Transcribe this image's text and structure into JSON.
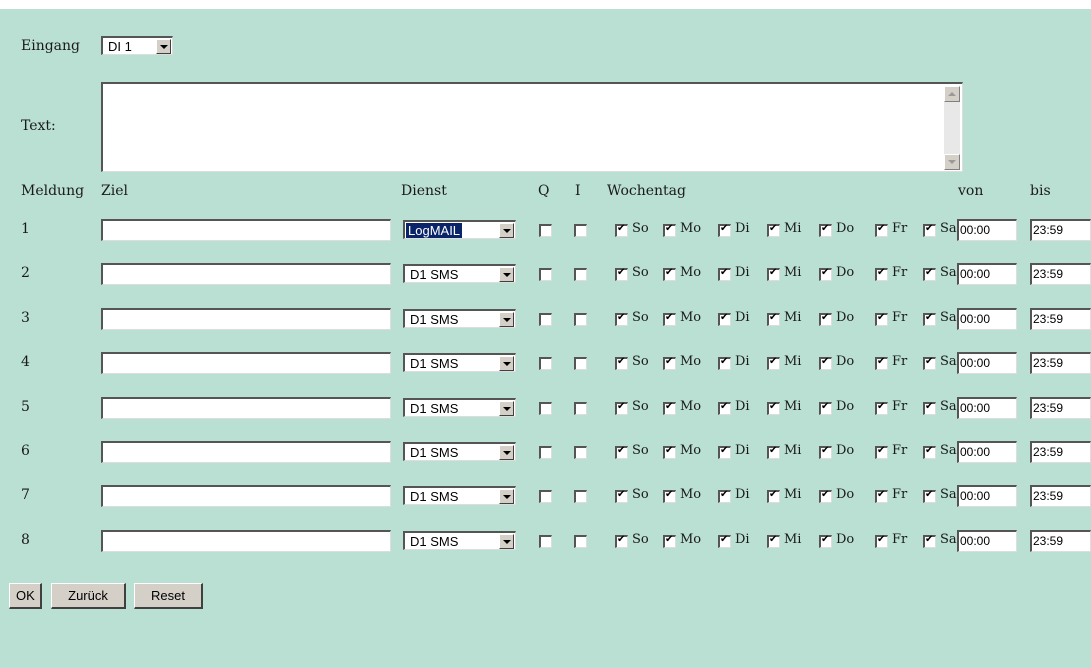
{
  "header": {
    "eingang_label": "Eingang",
    "eingang_value": "DI 1",
    "text_label": "Text:",
    "text_value": ""
  },
  "columns": {
    "meldung": "Meldung",
    "ziel": "Ziel",
    "dienst": "Dienst",
    "q": "Q",
    "i": "I",
    "wochentag": "Wochentag",
    "von": "von",
    "bis": "bis"
  },
  "days": [
    "So",
    "Mo",
    "Di",
    "Mi",
    "Do",
    "Fr",
    "Sa"
  ],
  "rows": [
    {
      "num": "1",
      "ziel": "",
      "dienst": "LogMAIL",
      "dienst_highlighted": true,
      "q": false,
      "i": false,
      "days": [
        true,
        true,
        true,
        true,
        true,
        true,
        true
      ],
      "von": "00:00",
      "bis": "23:59"
    },
    {
      "num": "2",
      "ziel": "",
      "dienst": "D1 SMS",
      "dienst_highlighted": false,
      "q": false,
      "i": false,
      "days": [
        true,
        true,
        true,
        true,
        true,
        true,
        true
      ],
      "von": "00:00",
      "bis": "23:59"
    },
    {
      "num": "3",
      "ziel": "",
      "dienst": "D1 SMS",
      "dienst_highlighted": false,
      "q": false,
      "i": false,
      "days": [
        true,
        true,
        true,
        true,
        true,
        true,
        true
      ],
      "von": "00:00",
      "bis": "23:59"
    },
    {
      "num": "4",
      "ziel": "",
      "dienst": "D1 SMS",
      "dienst_highlighted": false,
      "q": false,
      "i": false,
      "days": [
        true,
        true,
        true,
        true,
        true,
        true,
        true
      ],
      "von": "00:00",
      "bis": "23:59"
    },
    {
      "num": "5",
      "ziel": "",
      "dienst": "D1 SMS",
      "dienst_highlighted": false,
      "q": false,
      "i": false,
      "days": [
        true,
        true,
        true,
        true,
        true,
        true,
        true
      ],
      "von": "00:00",
      "bis": "23:59"
    },
    {
      "num": "6",
      "ziel": "",
      "dienst": "D1 SMS",
      "dienst_highlighted": false,
      "q": false,
      "i": false,
      "days": [
        true,
        true,
        true,
        true,
        true,
        true,
        true
      ],
      "von": "00:00",
      "bis": "23:59"
    },
    {
      "num": "7",
      "ziel": "",
      "dienst": "D1 SMS",
      "dienst_highlighted": false,
      "q": false,
      "i": false,
      "days": [
        true,
        true,
        true,
        true,
        true,
        true,
        true
      ],
      "von": "00:00",
      "bis": "23:59"
    },
    {
      "num": "8",
      "ziel": "",
      "dienst": "D1 SMS",
      "dienst_highlighted": false,
      "q": false,
      "i": false,
      "days": [
        true,
        true,
        true,
        true,
        true,
        true,
        true
      ],
      "von": "00:00",
      "bis": "23:59"
    }
  ],
  "buttons": {
    "ok": "OK",
    "zurueck": "Zurück",
    "reset": "Reset"
  }
}
